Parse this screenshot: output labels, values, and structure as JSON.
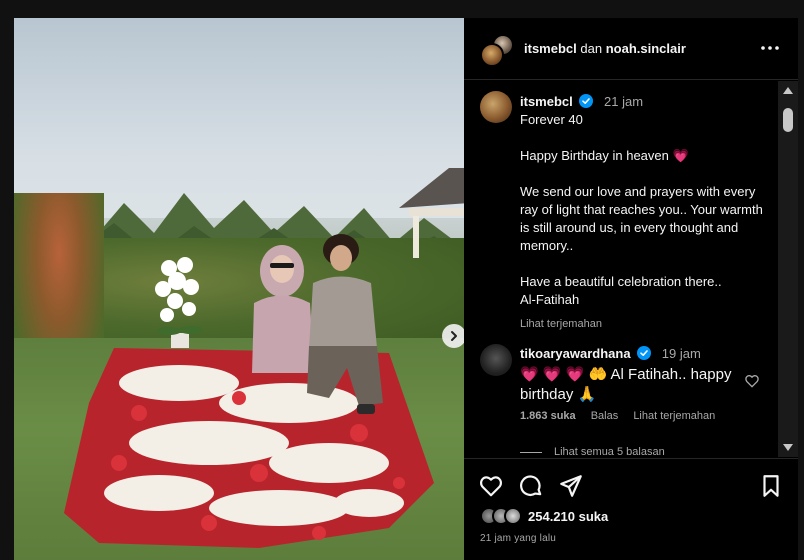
{
  "header": {
    "user1": "itsmebcl",
    "conjunction": "dan",
    "user2": "noah.sinclair"
  },
  "caption": {
    "username": "itsmebcl",
    "time": "21 jam",
    "text": "Forever 40\n\nHappy Birthday in heaven 💗\n\nWe send our love and prayers with every ray of light that reaches you.. Your warmth is still around us, in every thought and memory..\n\nHave a beautiful celebration there..\nAl-Fatihah",
    "translate": "Lihat terjemahan"
  },
  "comment": {
    "username": "tikoaryawardhana",
    "time": "19 jam",
    "text": "💗 💗 💗 🤲 Al Fatihah.. happy birthday 🙏",
    "likes": "1.863 suka",
    "reply": "Balas",
    "translate": "Lihat terjemahan",
    "view_replies": "Lihat semua 5 balasan"
  },
  "post": {
    "likes": "254.210 suka",
    "posted": "21 jam yang lalu"
  },
  "icons": {
    "more": "more-options-icon",
    "like": "heart-icon",
    "comment": "comment-icon",
    "share": "send-icon",
    "save": "bookmark-icon",
    "next": "chevron-right-icon"
  },
  "colors": {
    "verified": "#0095f6",
    "background": "#000000",
    "muted": "#a8a8a8"
  }
}
